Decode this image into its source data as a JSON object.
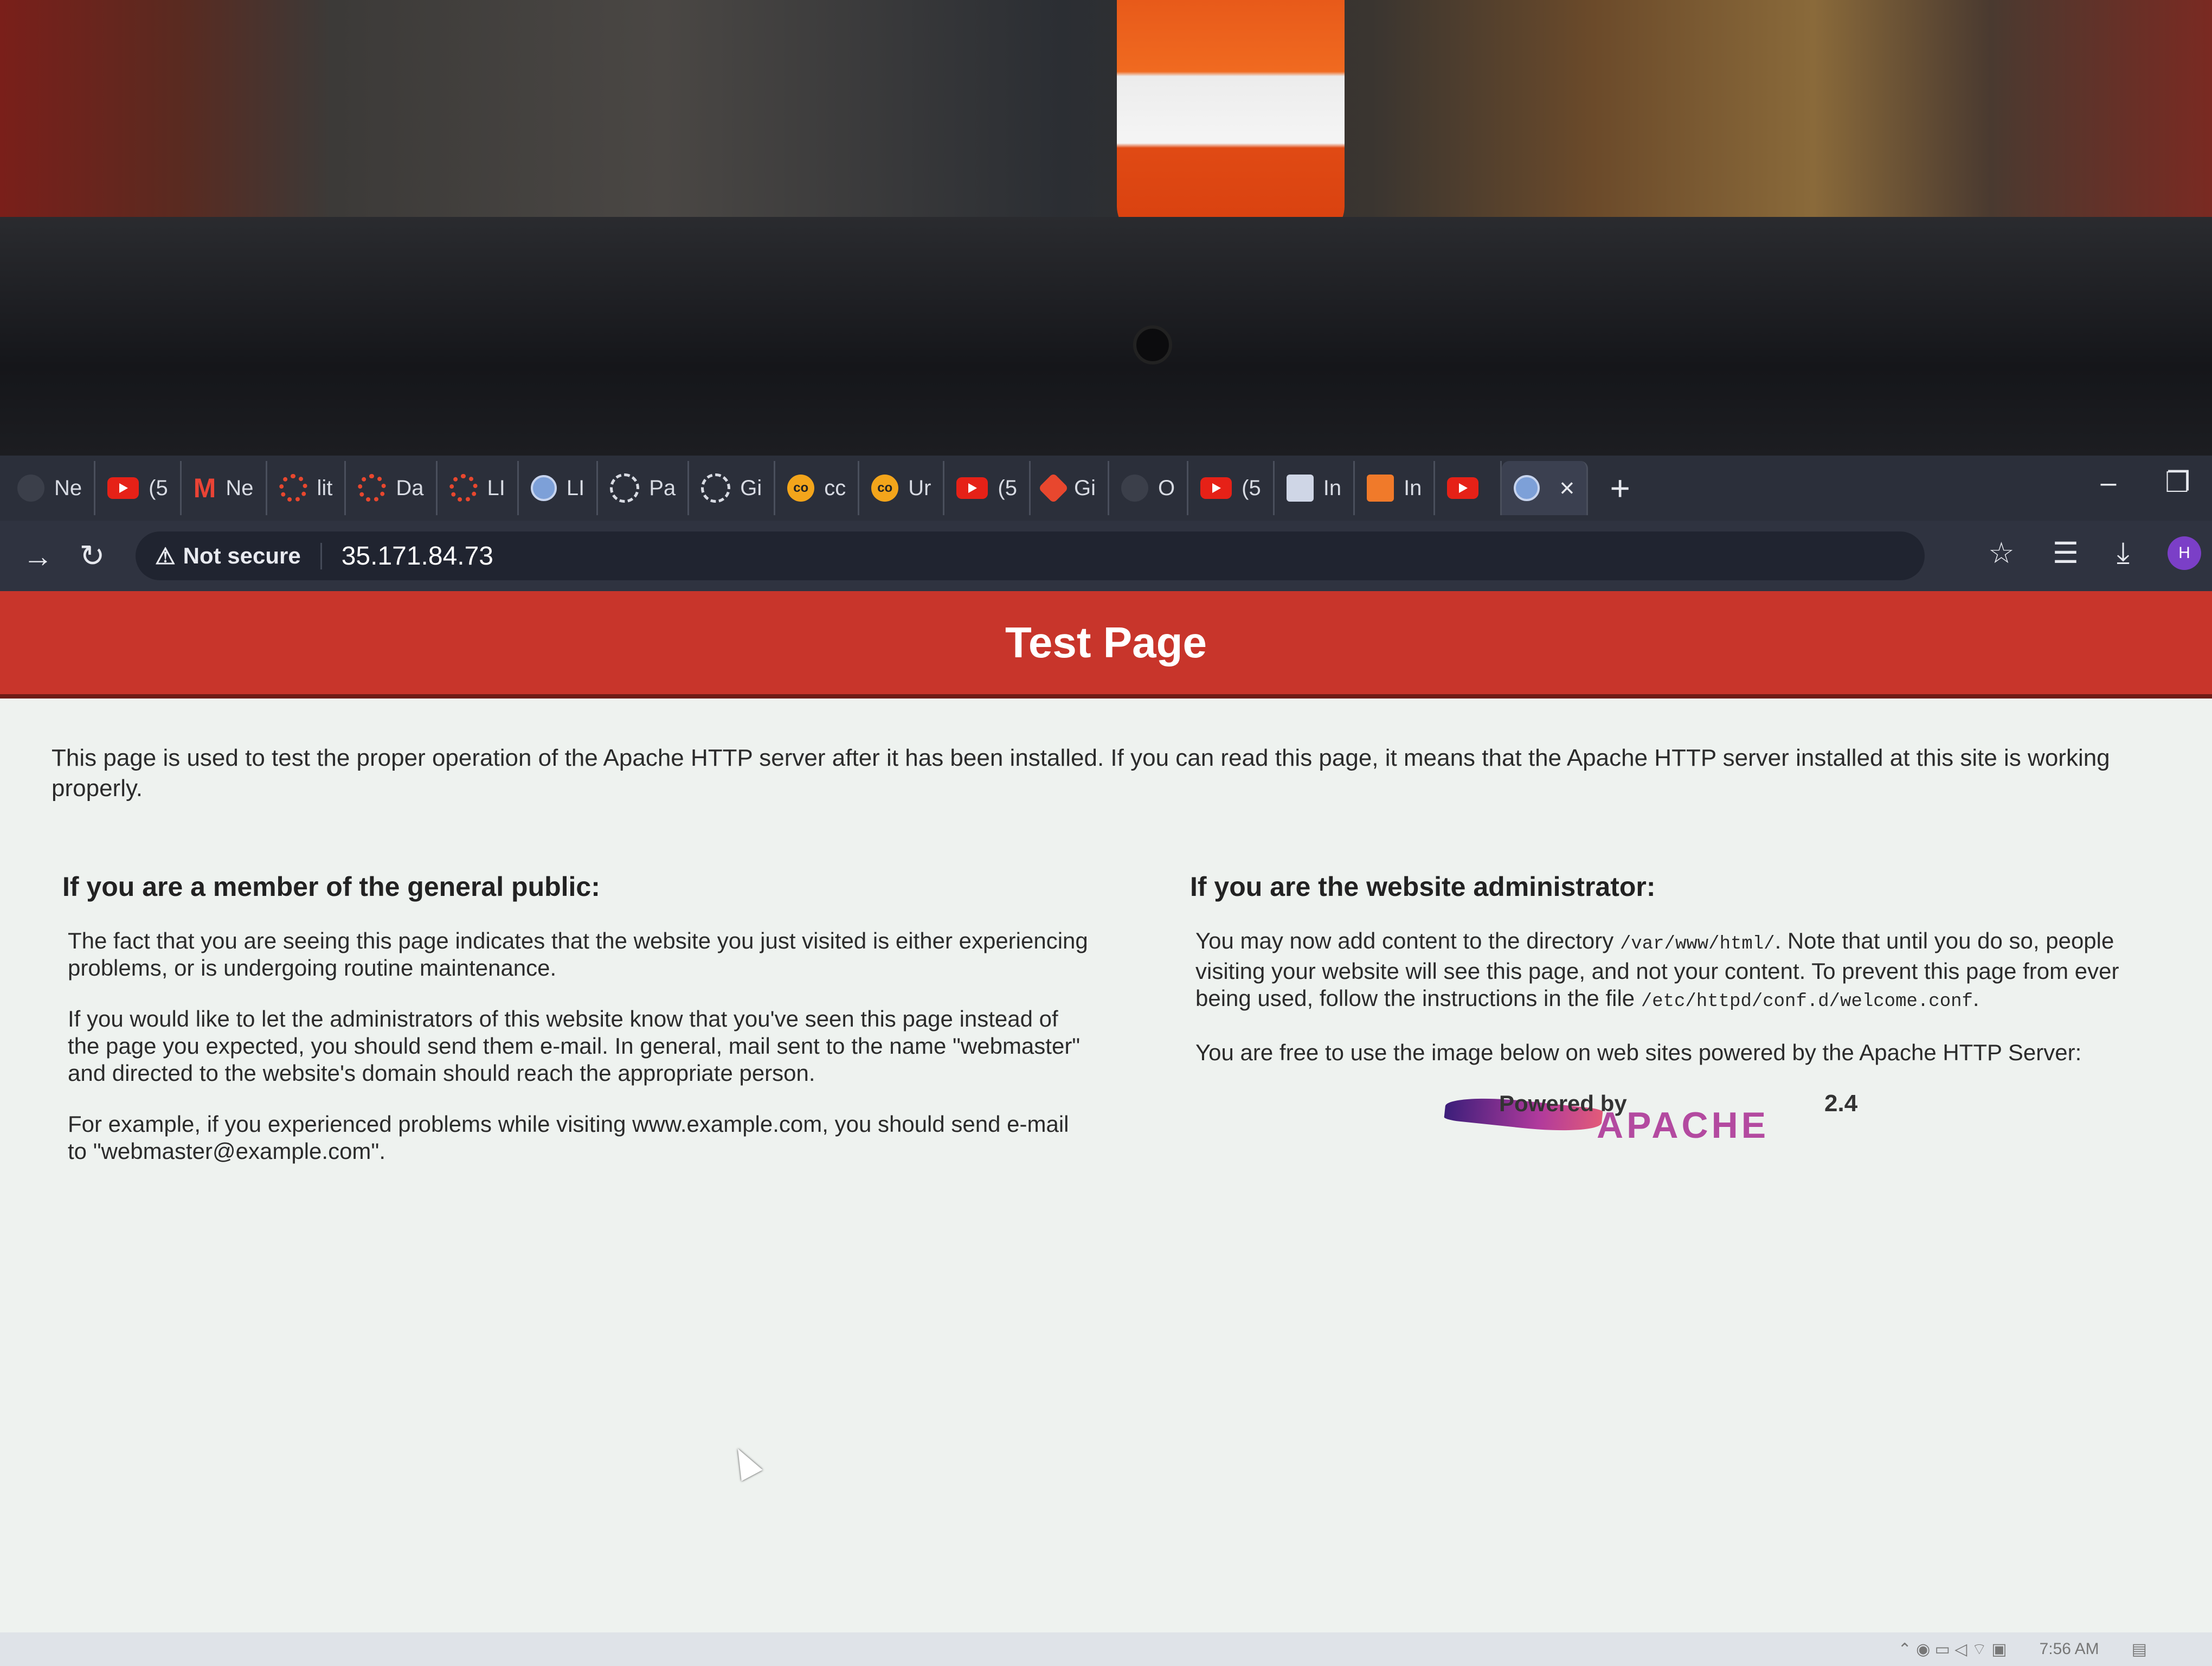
{
  "browser": {
    "tabs": [
      {
        "label": "Ne",
        "icon": "github-icon",
        "fav": "dark"
      },
      {
        "label": "(5",
        "icon": "youtube-icon",
        "fav": "yt"
      },
      {
        "label": "Ne",
        "icon": "gmail-icon",
        "fav": "gm"
      },
      {
        "label": "lit",
        "icon": "ring-icon",
        "fav": "ring-red"
      },
      {
        "label": "Da",
        "icon": "ring-icon",
        "fav": "ring-red"
      },
      {
        "label": "LI",
        "icon": "ring-icon",
        "fav": "ring-red"
      },
      {
        "label": "LI",
        "icon": "globe-icon",
        "fav": "globe"
      },
      {
        "label": "Pa",
        "icon": "loading-icon",
        "fav": "ring-white"
      },
      {
        "label": "Gi",
        "icon": "loading-icon",
        "fav": "ring-white"
      },
      {
        "label": "cc",
        "icon": "codeforces-icon",
        "fav": "co"
      },
      {
        "label": "Ur",
        "icon": "codeforces-icon",
        "fav": "co"
      },
      {
        "label": "(5",
        "icon": "youtube-icon",
        "fav": "yt"
      },
      {
        "label": "Gi",
        "icon": "git-icon",
        "fav": "gi"
      },
      {
        "label": "O",
        "icon": "site-icon",
        "fav": "dark"
      },
      {
        "label": "(5",
        "icon": "youtube-icon",
        "fav": "yt"
      },
      {
        "label": "In",
        "icon": "image-icon",
        "fav": "inimg"
      },
      {
        "label": "In",
        "icon": "app-icon",
        "fav": "inorg"
      },
      {
        "label": "",
        "icon": "youtube-icon",
        "fav": "yt"
      }
    ],
    "close_glyph": "×",
    "new_tab_glyph": "+",
    "security_label": "Not secure",
    "url": "35.171.84.73",
    "profile_initial": "H"
  },
  "page": {
    "title": "Test Page",
    "intro": "This page is used to test the proper operation of the Apache HTTP server after it has been installed. If you can read this page, it means that the Apache HTTP server installed at this site is working properly.",
    "public": {
      "heading": "If you are a member of the general public:",
      "p1": "The fact that you are seeing this page indicates that the website you just visited is either experiencing problems, or is undergoing routine maintenance.",
      "p2": "If you would like to let the administrators of this website know that you've seen this page instead of the page you expected, you should send them e-mail. In general, mail sent to the name \"webmaster\" and directed to the website's domain should reach the appropriate person.",
      "p3": "For example, if you experienced problems while visiting www.example.com, you should send e-mail to \"webmaster@example.com\"."
    },
    "admin": {
      "heading": "If you are the website administrator:",
      "p1_a": "You may now add content to the directory ",
      "p1_dir": "/var/www/html/",
      "p1_b": ". Note that until you do so, people visiting your website will see this page, and not your content. To prevent this page from ever being used, follow the instructions in the file ",
      "p1_file": "/etc/httpd/conf.d/welcome.conf",
      "p1_c": ".",
      "p2": "You are free to use the image below on web sites powered by the Apache HTTP Server:"
    },
    "badge": {
      "powered_by": "Powered by",
      "name": "APACHE",
      "version": "2.4"
    }
  },
  "taskbar": {
    "clock": "7:56 AM"
  }
}
